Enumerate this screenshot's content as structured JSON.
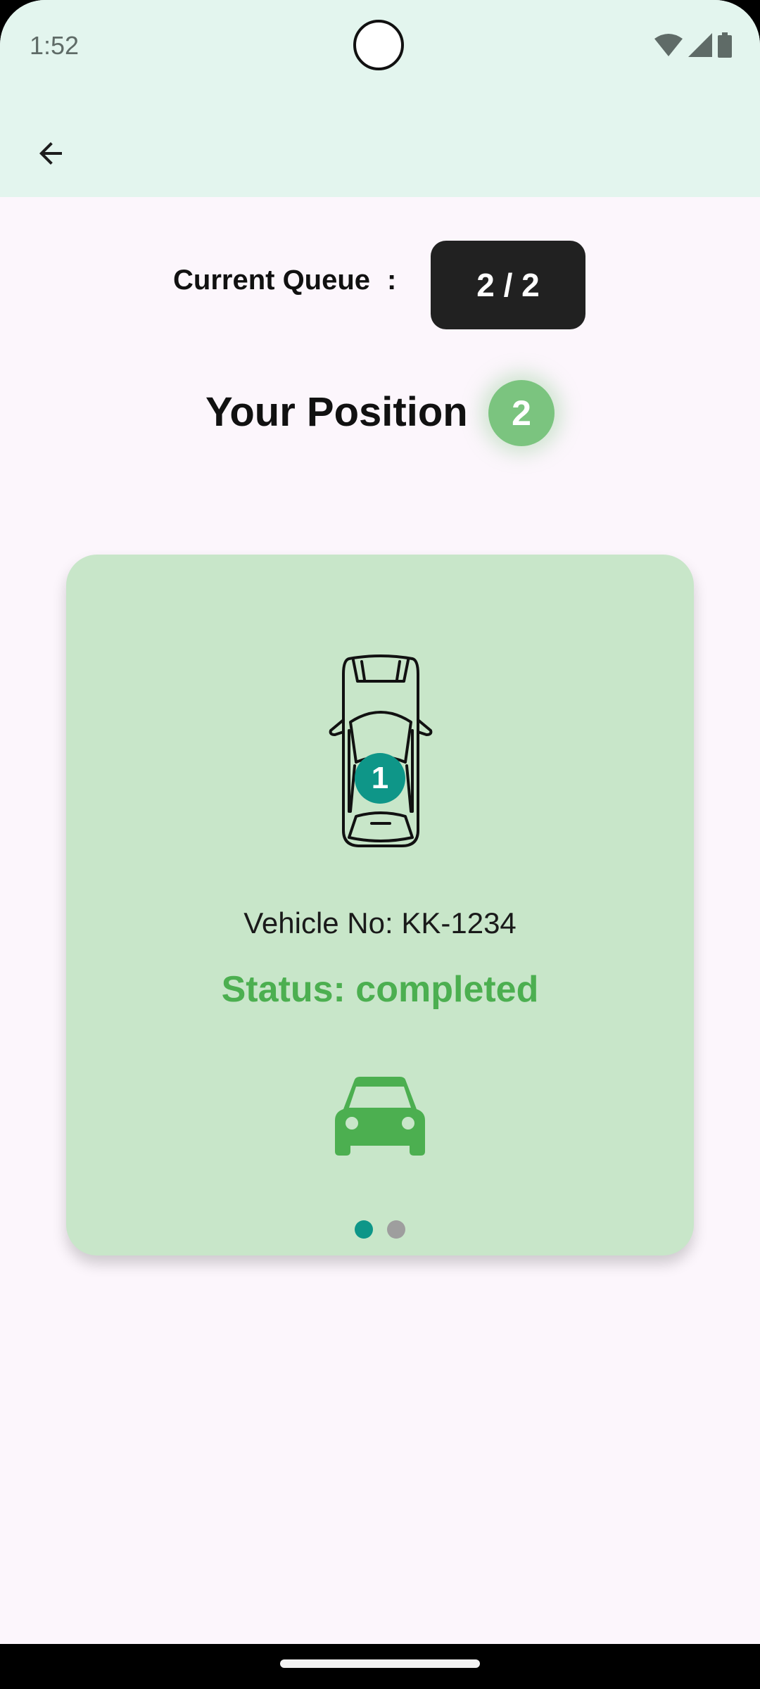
{
  "status_bar": {
    "time": "1:52",
    "icons": [
      "wifi-icon",
      "cellular-signal-icon",
      "battery-icon"
    ]
  },
  "app_bar": {
    "back_icon": "arrow-back-icon"
  },
  "queue": {
    "label": "Current Queue",
    "separator": ":",
    "value": "2 / 2"
  },
  "position": {
    "label": "Your Position",
    "value": "2"
  },
  "card": {
    "car_badge_number": "1",
    "vehicle_no": "Vehicle No: KK-1234",
    "status": "Status: completed",
    "car_icon": "car-icon",
    "page_indicator": {
      "count": 2,
      "active_index": 0
    }
  },
  "colors": {
    "app_bar_bg": "#e3f5ee",
    "screen_bg": "#fcf6fc",
    "card_bg": "#c8e6c9",
    "status_green": "#4caf50",
    "position_badge": "#7bc47f",
    "car_badge_teal": "#0e9688",
    "queue_badge_bg": "#212121",
    "dot_active": "#0e9688",
    "dot_inactive": "#9e9e9e"
  }
}
